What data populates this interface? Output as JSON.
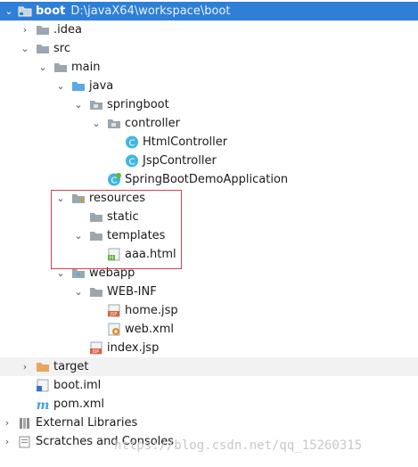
{
  "project": {
    "name": "boot",
    "path": "D:\\javaX64\\workspace\\boot"
  },
  "tree": {
    "idea": ".idea",
    "src": "src",
    "main": "main",
    "java": "java",
    "springboot": "springboot",
    "controller": "controller",
    "html_controller": "HtmlController",
    "jsp_controller": "JspController",
    "app": "SpringBootDemoApplication",
    "resources": "resources",
    "static": "static",
    "templates": "templates",
    "aaa": "aaa.html",
    "webapp": "webapp",
    "webinf": "WEB-INF",
    "home": "home.jsp",
    "webxml": "web.xml",
    "index": "index.jsp",
    "target": "target",
    "bootiml": "boot.iml",
    "pom": "pom.xml",
    "extlibs": "External Libraries",
    "scratches": "Scratches and Consoles"
  },
  "watermark": "https://blog.csdn.net/qq_15260315",
  "colors": {
    "selection": "#2f7fd7",
    "highlight_box": "#d9414b",
    "folder": "#9aa7b0",
    "class_icon": "#40b6e0",
    "target_folder": "#e9a65b"
  }
}
